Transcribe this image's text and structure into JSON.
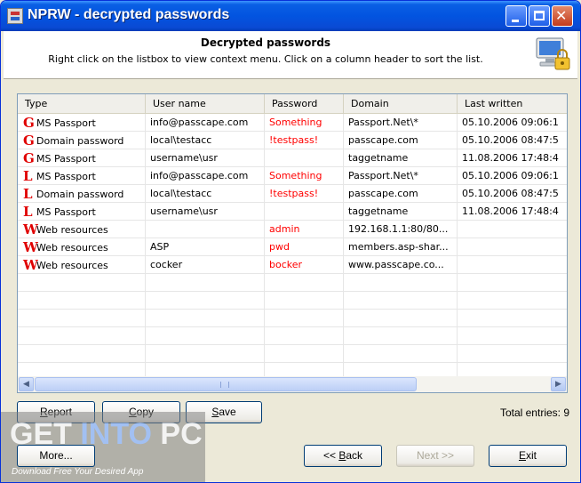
{
  "window": {
    "title": "NPRW - decrypted passwords"
  },
  "header": {
    "title": "Decrypted passwords",
    "subtitle": "Right click on the listbox to view context menu. Click on a column header to sort the list."
  },
  "list": {
    "columns": [
      "Type",
      "User name",
      "Password",
      "Domain",
      "Last written"
    ],
    "rows": [
      {
        "icon": "G",
        "type": "MS Passport",
        "user": "info@passcape.com",
        "password": "Something",
        "domain": "Passport.Net\\*",
        "last": "05.10.2006  09:06:1"
      },
      {
        "icon": "G",
        "type": "Domain password",
        "user": "local\\testacc",
        "password": "!testpass!",
        "domain": "passcape.com",
        "last": "05.10.2006  08:47:5"
      },
      {
        "icon": "G",
        "type": "MS Passport",
        "user": "username\\usr",
        "password": "",
        "domain": "taggetname",
        "last": "11.08.2006  17:48:4"
      },
      {
        "icon": "L",
        "type": "MS Passport",
        "user": "info@passcape.com",
        "password": "Something",
        "domain": "Passport.Net\\*",
        "last": "05.10.2006  09:06:1"
      },
      {
        "icon": "L",
        "type": "Domain password",
        "user": "local\\testacc",
        "password": "!testpass!",
        "domain": "passcape.com",
        "last": "05.10.2006  08:47:5"
      },
      {
        "icon": "L",
        "type": "MS Passport",
        "user": "username\\usr",
        "password": "",
        "domain": "taggetname",
        "last": "11.08.2006  17:48:4"
      },
      {
        "icon": "W",
        "type": "Web resources",
        "user": "",
        "password": "admin",
        "domain": "192.168.1.1:80/80...",
        "last": ""
      },
      {
        "icon": "W",
        "type": "Web resources",
        "user": "ASP",
        "password": "pwd",
        "domain": "members.asp-shar...",
        "last": ""
      },
      {
        "icon": "W",
        "type": "Web resources",
        "user": "cocker",
        "password": "bocker",
        "domain": "www.passcape.co...",
        "last": ""
      }
    ]
  },
  "buttons": {
    "report": {
      "first": "R",
      "rest": "eport"
    },
    "copy": {
      "first": "C",
      "rest": "opy"
    },
    "save": {
      "first": "S",
      "rest": "ave"
    },
    "more": "More...",
    "back_pre": "<< ",
    "back_first": "B",
    "back_rest": "ack",
    "next": "Next >>",
    "exit": {
      "first": "E",
      "rest": "xit"
    }
  },
  "status": {
    "total": "Total entries: 9"
  },
  "watermark": {
    "main_a": "GET ",
    "main_b": "INTO",
    "main_c": " PC",
    "sub": "Download Free Your Desired App"
  },
  "colors": {
    "password_text": "#ff0000",
    "title_bar": "#0254e0",
    "type_letter": "#e00000"
  }
}
